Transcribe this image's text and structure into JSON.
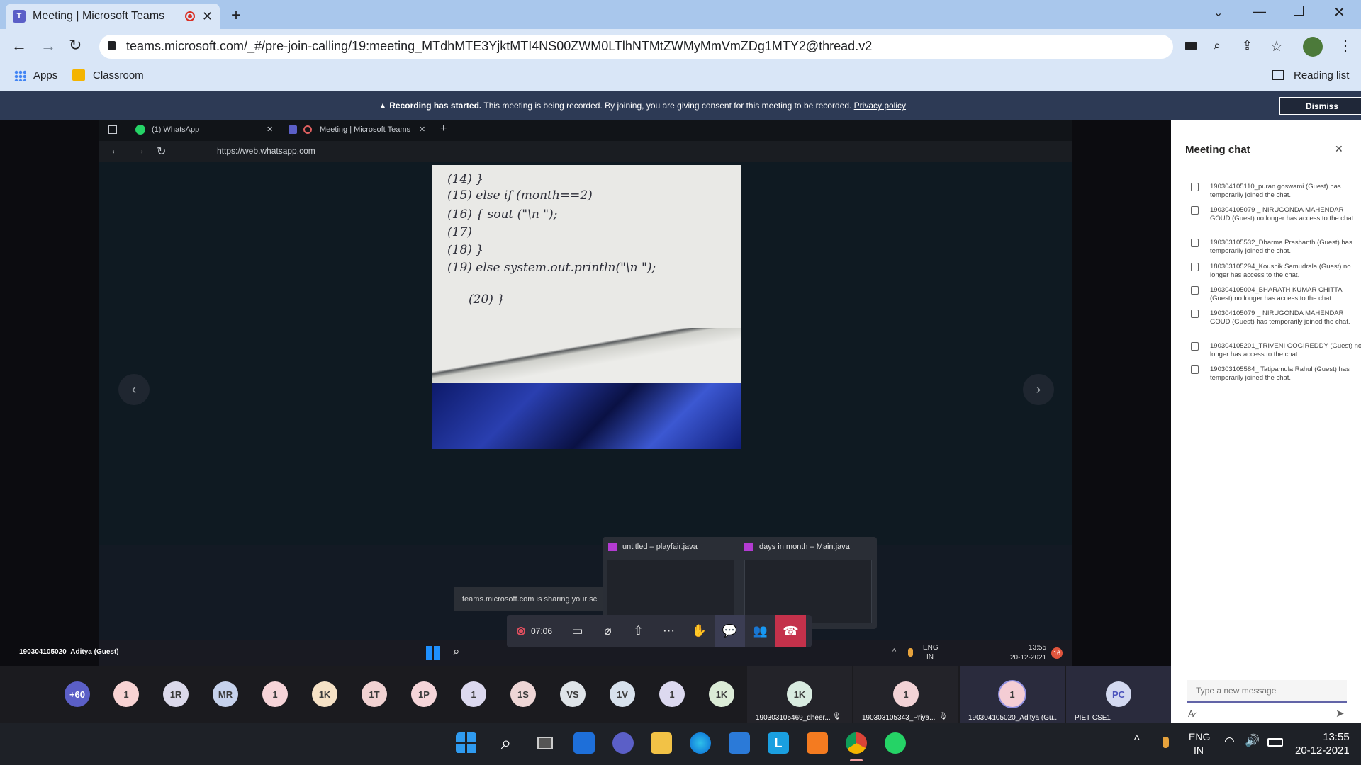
{
  "browser": {
    "tab_title": "Meeting | Microsoft Teams",
    "url": "teams.microsoft.com/_#/pre-join-calling/19:meeting_MTdhMTE3YjktMTI4NS00ZWM0LTlhNTMtZWMyMmVmZDg1MTY2@thread.v2",
    "bookmarks": [
      "Apps",
      "Classroom"
    ],
    "reading_list": "Reading list"
  },
  "banner": {
    "bold": "Recording has started.",
    "text": " This meeting is being recorded. By joining, you are giving consent for this meeting to be recorded. ",
    "privacy": "Privacy policy",
    "dismiss": "Dismiss"
  },
  "shared": {
    "tab1": "(1) WhatsApp",
    "tab2": "Meeting | Microsoft Teams",
    "url": "https://web.whatsapp.com",
    "handwriting": [
      "(14) }",
      "(15) else if (month==2)",
      "(16) {  sout (\"\\n \");",
      "(17)",
      "(18) }",
      "(19) else system.out.println(\"\\n \");",
      "(20) }"
    ],
    "preview1": "untitled – playfair.java",
    "preview2": "days in month – Main.java",
    "sharing_notice": "teams.microsoft.com is sharing your sc",
    "presenter": "190304105020_Aditya (Guest)",
    "inner_taskbar_time": "13:55",
    "inner_taskbar_date": "20-12-2021",
    "inner_lang": [
      "ENG",
      "IN"
    ],
    "inner_badge": "16"
  },
  "controls": {
    "timer": "07:06"
  },
  "participants": {
    "avatars": [
      {
        "label": "+60",
        "color": "#5b5fc7",
        "text_color": "#ffffff"
      },
      {
        "label": "1",
        "color": "#f8d3d3"
      },
      {
        "label": "1R",
        "color": "#dbd9ea"
      },
      {
        "label": "MR",
        "color": "#c6d2ec"
      },
      {
        "label": "1",
        "color": "#f6d4d8"
      },
      {
        "label": "1K",
        "color": "#f6e2c6"
      },
      {
        "label": "1T",
        "color": "#f1d2d2"
      },
      {
        "label": "1P",
        "color": "#f5d5d9"
      },
      {
        "label": "1",
        "color": "#dcd9ef"
      },
      {
        "label": "1S",
        "color": "#eed6d6"
      },
      {
        "label": "VS",
        "color": "#dfe4e8"
      },
      {
        "label": "1V",
        "color": "#d8e2ed"
      },
      {
        "label": "1",
        "color": "#dcd9ef"
      },
      {
        "label": "1K",
        "color": "#dcecd7"
      }
    ],
    "tiles": [
      {
        "label": "1K",
        "color": "#d8ebe0",
        "name": "190303105469_dheer..."
      },
      {
        "label": "1",
        "color": "#f2d3d6",
        "name": "190303105343_Priya..."
      },
      {
        "label": "1",
        "color": "#f4cdd4",
        "name": "190304105020_Aditya (Gu..."
      },
      {
        "label": "PC",
        "color": "#d3d9f0",
        "name": "PIET CSE1"
      }
    ]
  },
  "chat": {
    "title": "Meeting chat",
    "messages": [
      "190304105110_puran goswami (Guest) has temporarily joined the chat.",
      "190304105079 _ NIRUGONDA MAHENDAR GOUD (Guest) no longer has access to the chat.",
      "190303105532_Dharma Prashanth (Guest) has temporarily joined the chat.",
      "180303105294_Koushik Samudrala (Guest) no longer has access to the chat.",
      "190304105004_BHARATH KUMAR CHITTA (Guest) no longer has access to the chat.",
      "190304105079 _ NIRUGONDA MAHENDAR GOUD (Guest) has temporarily joined the chat.",
      "190304105201_TRIVENI GOGIREDDY (Guest) no longer has access to the chat.",
      "190303105584_ Tatipamula Rahul (Guest) has temporarily joined the chat."
    ],
    "placeholder": "Type a new message"
  },
  "taskbar": {
    "lang1": "ENG",
    "lang2": "IN",
    "time": "13:55",
    "date": "20-12-2021"
  }
}
